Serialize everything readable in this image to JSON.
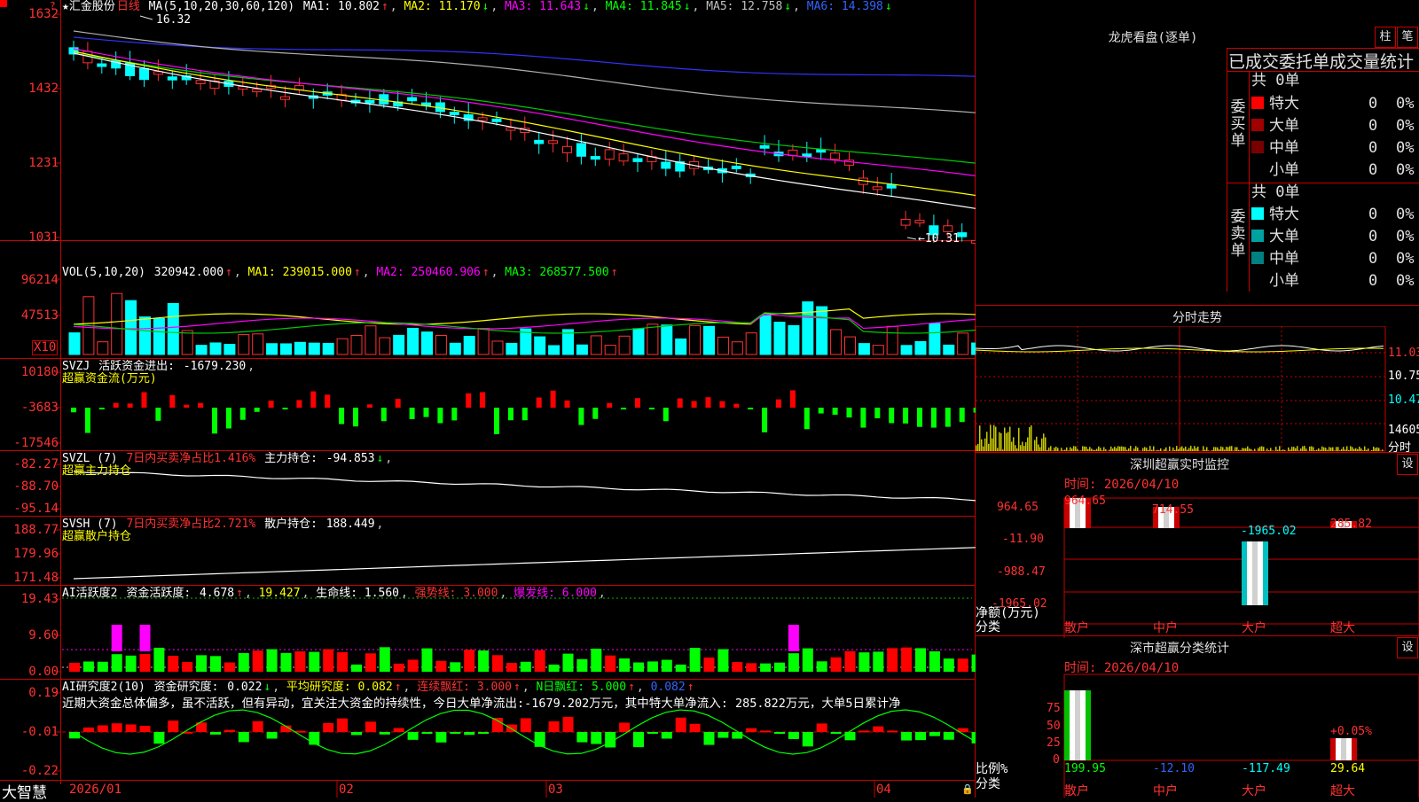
{
  "stock": {
    "name": "★汇金股份",
    "period": "日线",
    "high_label": "16.32",
    "low_label": "10.31",
    "ma_header": {
      "prefix": "MA(5,10,20,30,60,120)",
      "ma1": "MA1: 10.802",
      "ma2": "MA2: 11.170",
      "ma3": "MA3: 11.643",
      "ma4": "MA4: 11.845",
      "ma5": "MA5: 12.758",
      "ma6": "MA6: 14.398"
    },
    "price_axis": [
      "1632",
      "1432",
      "1231",
      "1031"
    ]
  },
  "vol": {
    "header": {
      "prefix": "VOL(5,10,20)",
      "value": "320942.000",
      "ma1": "MA1: 239015.000",
      "ma2": "MA2: 250460.906",
      "ma3": "MA3: 268577.500"
    },
    "axis": [
      "96214",
      "47513"
    ],
    "unit": "X10"
  },
  "svzj": {
    "header": {
      "prefix": "SVZJ",
      "label": "活跃资金进出:",
      "value": "-1679.230"
    },
    "subtitle": "超赢资金流(万元)",
    "axis": [
      "10180",
      "-3683",
      "-17546"
    ]
  },
  "svzl": {
    "header": {
      "prefix": "SVZL (7)",
      "red": "7日内买卖净占比1.416%",
      "label": "主力持仓:",
      "value": "-94.853"
    },
    "subtitle": "超赢主力持仓",
    "axis": [
      "-82.27",
      "-88.70",
      "-95.14"
    ]
  },
  "svsh": {
    "header": {
      "prefix": "SVSH (7)",
      "red": "7日内买卖净占比2.721%",
      "label": "散户持仓:",
      "value": "188.449"
    },
    "subtitle": "超赢散户持仓",
    "axis": [
      "188.77",
      "179.96",
      "171.48"
    ]
  },
  "ai_active": {
    "header": {
      "prefix": "AI活跃度2",
      "label": "资金活跃度:",
      "v1": "4.678",
      "v2": "19.427",
      "life": "生命线: 1.560",
      "strong": "强势线: 3.000",
      "burst": "爆发线: 6.000"
    },
    "axis": [
      "19.43",
      "9.60",
      "0.00"
    ]
  },
  "ai_research": {
    "header": {
      "prefix": "AI研究度2(10)",
      "label": "资金研究度:",
      "v1": "0.022",
      "avg": "平均研究度: 0.082",
      "cont": "连续飘红: 3.000",
      "n": "N日飘红: 5.000",
      "v2": "0.082"
    },
    "comment": "近期大资金总体偏多，虽不活跃，但有异动，宜关注大资金的持续性，今日大单净流出:-1679.202万元，其中特大单净流入: 285.822万元，大单5日累计净",
    "axis": [
      "0.19",
      "-0.01",
      "-0.22"
    ]
  },
  "bottom": {
    "brand": "大智慧",
    "dates": [
      "2026/01",
      "02",
      "03",
      "04"
    ]
  },
  "right": {
    "lhb_title": "龙虎看盘(逐单)",
    "btn1": "柱",
    "btn2": "笔",
    "tabs": "已成交委托单成交量统计",
    "buy_label": "委买单",
    "sell_label": "委卖单",
    "buy_total": "共 0单",
    "sell_total": "共 0单",
    "buy_rows": [
      {
        "name": "特大",
        "count": "0",
        "pct": "0%",
        "color": "#ff0000"
      },
      {
        "name": "大单",
        "count": "0",
        "pct": "0%",
        "color": "#a00000"
      },
      {
        "name": "中单",
        "count": "0",
        "pct": "0%",
        "color": "#780000"
      },
      {
        "name": "小单",
        "count": "0",
        "pct": "0%",
        "color": "#000000"
      }
    ],
    "sell_rows": [
      {
        "name": "特大",
        "count": "0",
        "pct": "0%",
        "color": "#00ffff"
      },
      {
        "name": "大单",
        "count": "0",
        "pct": "0%",
        "color": "#00a0a0"
      },
      {
        "name": "中单",
        "count": "0",
        "pct": "0%",
        "color": "#008080"
      },
      {
        "name": "小单",
        "count": "0",
        "pct": "0%",
        "color": "#000000"
      }
    ],
    "fenshi_title": "分时走势",
    "fenshi_axis": [
      "11.03",
      "10.75",
      "10.47",
      "14605",
      "分时"
    ],
    "monitor_title": "深圳超赢实时监控",
    "setting": "设",
    "monitor_time": "时间: 2026/04/10",
    "monitor_axis": [
      "964.65",
      "-11.90",
      "-988.47",
      "-1965.02"
    ],
    "monitor_ylabel": "净额(万元)",
    "monitor_xlabel": "分类",
    "monitor_values": {
      "sanhu": "964.65",
      "zhonghu": "714.55",
      "dahu": "-1965.02",
      "chaoda": "285.82"
    },
    "monitor_cats": [
      "散户",
      "中户",
      "大户",
      "超大"
    ],
    "class_title": "深市超赢分类统计",
    "class_time": "时间: 2026/04/10",
    "class_axis": [
      "75",
      "50",
      "25",
      "0"
    ],
    "class_ylabel": "比例%",
    "class_xlabel": "分类",
    "class_values": {
      "sanhu": "199.95",
      "zhonghu": "-12.10",
      "dahu": "-117.49",
      "chaoda": "29.64",
      "chaoda_pct": "+0.05%"
    },
    "class_cats": [
      "散户",
      "中户",
      "大户",
      "超大"
    ]
  }
}
